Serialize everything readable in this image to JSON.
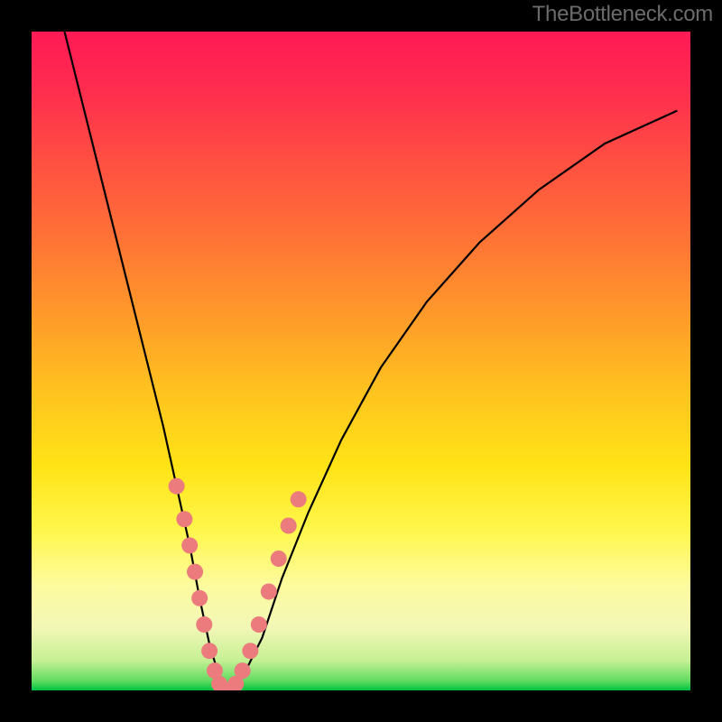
{
  "watermark": "TheBottleneck.com",
  "chart_data": {
    "type": "line",
    "title": "",
    "xlabel": "",
    "ylabel": "",
    "xlim": [
      0,
      100
    ],
    "ylim": [
      0,
      100
    ],
    "background_gradient_stops": [
      {
        "offset": 0.0,
        "color": "#ff1a55"
      },
      {
        "offset": 0.08,
        "color": "#ff2a4f"
      },
      {
        "offset": 0.18,
        "color": "#ff4a44"
      },
      {
        "offset": 0.3,
        "color": "#ff6e37"
      },
      {
        "offset": 0.42,
        "color": "#ff962b"
      },
      {
        "offset": 0.55,
        "color": "#ffc41f"
      },
      {
        "offset": 0.66,
        "color": "#ffe316"
      },
      {
        "offset": 0.76,
        "color": "#fff74e"
      },
      {
        "offset": 0.84,
        "color": "#fdfb9e"
      },
      {
        "offset": 0.905,
        "color": "#f2f7b6"
      },
      {
        "offset": 0.955,
        "color": "#c5f093"
      },
      {
        "offset": 0.985,
        "color": "#63dc63"
      },
      {
        "offset": 1.0,
        "color": "#00c23e"
      }
    ],
    "series": [
      {
        "name": "bottleneck-curve",
        "x": [
          5,
          8,
          11,
          14,
          17,
          20,
          22,
          24,
          25.5,
          27,
          28.5,
          30,
          32,
          35,
          38,
          42,
          47,
          53,
          60,
          68,
          77,
          87,
          98
        ],
        "y": [
          100,
          88,
          76,
          64,
          52,
          40,
          31,
          22,
          14,
          7,
          2,
          0,
          2,
          8,
          17,
          27,
          38,
          49,
          59,
          68,
          76,
          83,
          88
        ]
      }
    ],
    "markers": {
      "name": "highlight-dots",
      "color": "#ec7b7d",
      "radius_px": 9,
      "points": [
        {
          "x": 22.0,
          "y": 31
        },
        {
          "x": 23.2,
          "y": 26
        },
        {
          "x": 24.0,
          "y": 22
        },
        {
          "x": 24.8,
          "y": 18
        },
        {
          "x": 25.5,
          "y": 14
        },
        {
          "x": 26.2,
          "y": 10
        },
        {
          "x": 27.0,
          "y": 6
        },
        {
          "x": 27.8,
          "y": 3
        },
        {
          "x": 28.5,
          "y": 1
        },
        {
          "x": 29.3,
          "y": 0
        },
        {
          "x": 30.2,
          "y": 0
        },
        {
          "x": 31.0,
          "y": 1
        },
        {
          "x": 32.0,
          "y": 3
        },
        {
          "x": 33.2,
          "y": 6
        },
        {
          "x": 34.5,
          "y": 10
        },
        {
          "x": 36.0,
          "y": 15
        },
        {
          "x": 37.5,
          "y": 20
        },
        {
          "x": 39.0,
          "y": 25
        },
        {
          "x": 40.5,
          "y": 29
        }
      ]
    }
  }
}
